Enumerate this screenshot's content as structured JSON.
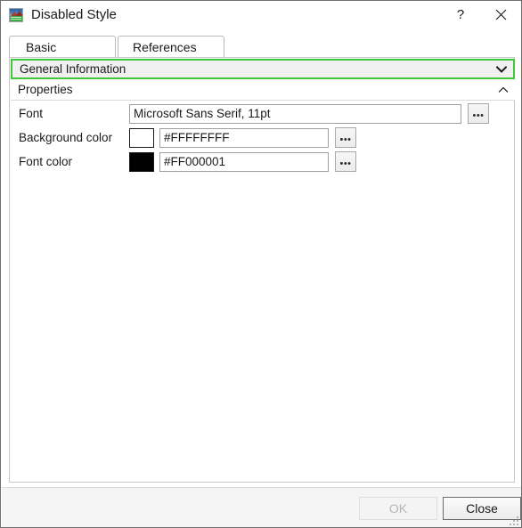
{
  "window": {
    "title": "Disabled Style",
    "icon": "picture-icon",
    "help_label": "?",
    "close_label": "✕"
  },
  "tabs": [
    {
      "label": "Basic",
      "selected": true
    },
    {
      "label": "References",
      "selected": false
    }
  ],
  "groups": [
    {
      "label": "General Information",
      "expanded": false,
      "chevron": "chevron-down-icon",
      "focused": true,
      "focus_color": "#3DC83D"
    },
    {
      "label": "Properties",
      "expanded": true,
      "chevron": "chevron-up-icon",
      "focused": false
    }
  ],
  "properties": [
    {
      "label": "Font",
      "value": "Microsoft Sans Serif, 11pt",
      "has_swatch": false,
      "browse_label": "•••"
    },
    {
      "label": "Background color",
      "value": "#FFFFFFFF",
      "has_swatch": true,
      "swatch_color": "#FFFFFF",
      "browse_label": "•••"
    },
    {
      "label": "Font color",
      "value": "#FF000001",
      "has_swatch": true,
      "swatch_color": "#000000",
      "browse_label": "•••"
    }
  ],
  "footer": {
    "ok_label": "OK",
    "ok_enabled": false,
    "close_label": "Close",
    "close_enabled": true
  }
}
